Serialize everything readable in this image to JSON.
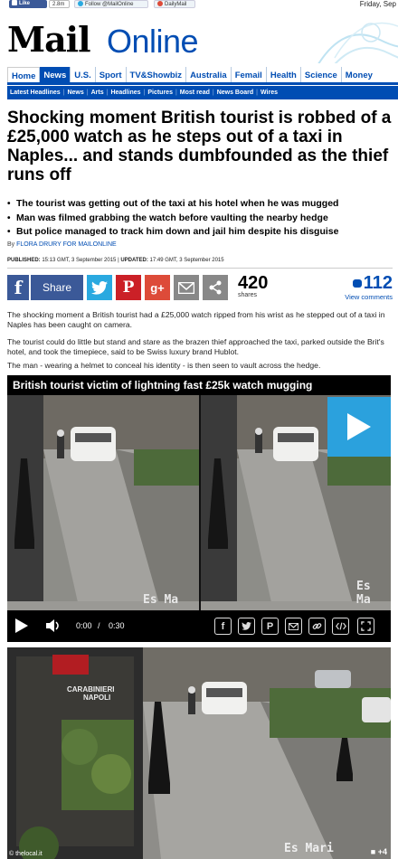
{
  "social": {
    "facebook_like": "Like",
    "like_count": "2.8m",
    "twitter_follow": "Follow @MailOnline",
    "google_plus": "DailyMail",
    "date": "Friday, Sep"
  },
  "masthead": {
    "logo_main": "Mail",
    "logo_sub": "Online"
  },
  "nav": {
    "items": [
      "Home",
      "News",
      "U.S.",
      "Sport",
      "TV&Showbiz",
      "Australia",
      "Femail",
      "Health",
      "Science",
      "Money"
    ],
    "active": "News"
  },
  "subnav": {
    "items": [
      "Latest Headlines",
      "News",
      "Arts",
      "Headlines",
      "Pictures",
      "Most read",
      "News Board",
      "Wires"
    ]
  },
  "article": {
    "headline": "Shocking moment British tourist is robbed of a £25,000 watch as he steps out of a taxi in Naples... and stands dumbfounded as the thief runs off",
    "bullets": [
      "The tourist was getting out of the taxi at his hotel when he was mugged",
      "Man was filmed grabbing the watch before vaulting the nearby hedge",
      "But police managed to track him down and jail him despite his disguise"
    ],
    "byline_prefix": "By",
    "author": "FLORA DRURY FOR MAILONLINE",
    "published_label": "PUBLISHED:",
    "published": "15:13 GMT, 3 September 2015",
    "updated_label": "UPDATED:",
    "updated": "17:49 GMT, 3 September 2015",
    "paragraphs": [
      "The shocking moment a British tourist had a £25,000 watch ripped from his wrist as he stepped out of a taxi in Naples has been caught on camera.",
      "The tourist could do little but stand and stare as the brazen thief approached the taxi, parked outside the Brit's hotel, and took the timepiece, said to be Swiss luxury brand Hublot.",
      "The man - wearing a helmet to conceal his identity - is then seen to vault across the hedge."
    ]
  },
  "share": {
    "facebook_letter": "f",
    "share_label": "Share",
    "pinterest_letter": "P",
    "gplus_label": "g+",
    "share_count": "420",
    "share_count_label": "shares",
    "comment_count": "112",
    "comment_label": "View comments"
  },
  "video": {
    "title": "British tourist victim of lightning fast £25k watch mugging",
    "current_time": "0:00",
    "separator": "/",
    "duration": "0:30",
    "watermark": "Es Ma"
  },
  "photo": {
    "credit": "© thelocal.it",
    "photo_count": "+4",
    "watermark": "Es Mari",
    "sign_line1": "CARABINIERI",
    "sign_line2": "NAPOLI"
  },
  "colors": {
    "brand_blue": "#004db3",
    "facebook": "#3b5998",
    "twitter": "#2aa9e0",
    "pinterest": "#cb2027",
    "gplus": "#dd4b39",
    "video_play": "#2ba1dd"
  }
}
